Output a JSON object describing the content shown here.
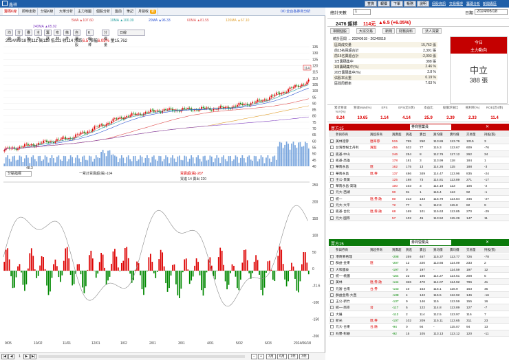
{
  "app": {
    "title": "鑫祥",
    "top_buttons": [
      "查詢",
      "報價",
      "下單",
      "帳務",
      "說明"
    ],
    "top_links": [
      "個股資訊",
      "交易權證",
      "籌碼分析",
      "新聞專區"
    ]
  },
  "chart_tabs": [
    "籌碼K線",
    "即時走勢",
    "分點K線",
    "大單分析",
    "主力地圖",
    "個股分析",
    "盤前",
    "筆記",
    "月營收"
  ],
  "chart_tabs_badge": "新",
  "stock_header": {
    "right_info": "0/0 全台各券商分析"
  },
  "ma_legend": [
    {
      "label": "5MA",
      "value": "▲107.60",
      "color": "#d63a3a"
    },
    {
      "label": "10MA",
      "value": "▲100.39",
      "color": "#25a0a0"
    },
    {
      "label": "20MA",
      "value": "▲96.33",
      "color": "#2850d0"
    },
    {
      "label": "60MA",
      "value": "▲81.55",
      "color": "#e05050"
    },
    {
      "label": "120MA",
      "value": "▲67.10",
      "color": "#e0a030"
    },
    {
      "label": "240MA",
      "value": "▲65.92",
      "color": "#8040c0"
    }
  ],
  "op_buttons": [
    "均線",
    "分類",
    "疊加",
    "主力",
    "籌碼",
    "布林",
    "條件",
    "自選股",
    "K線棒",
    "分價量",
    "日線"
  ],
  "ohlc": {
    "date": "2024/06/18",
    "open_label": "開",
    "open": "111",
    "high_label": "高",
    "high": "118",
    "low_label": "低",
    "low": "111",
    "close_label": "收",
    "close": "114",
    "change_label": "漲跌",
    "change": "6.5",
    "pct_label": "漲幅",
    "pct": "6.05%",
    "vol_label": "量",
    "volume": "15,762"
  },
  "price_axis": [
    "135",
    "130",
    "125",
    "120",
    "115",
    "110",
    "105",
    "100",
    "95",
    "90",
    "85",
    "80",
    "75",
    "70",
    "65",
    "60",
    "55",
    "50",
    "45",
    "40"
  ],
  "price_marker": "114",
  "low_marker": "48.3",
  "indicator_header": {
    "select": "分點指標",
    "legend1": "一累計買賣超(張)-104",
    "legend2": "買賣超(張)-207",
    "legend3": "買進 14 賣出 220"
  },
  "indicator_axis": [
    "250",
    "200",
    "150",
    "100",
    "50",
    "0",
    "-21.6",
    "-100",
    "-150",
    "-200"
  ],
  "x_axis": [
    {
      "text": "9/05"
    },
    {
      "text": "10/02"
    },
    {
      "text": "11/01"
    },
    {
      "text": "12/01"
    },
    {
      "text": "1/02"
    },
    {
      "text": "2/01"
    },
    {
      "text": "3/01"
    },
    {
      "text": "4/01"
    },
    {
      "text": "5/02"
    },
    {
      "text": "6/03"
    },
    {
      "text": "2024/06/18"
    }
  ],
  "x_years": {
    "y2023": "2023",
    "y2024": "2024"
  },
  "bottom_nav": {
    "page": "1",
    "buttons": [
      "3月",
      "6月",
      "1年",
      "3年"
    ]
  },
  "right_panel": {
    "summary": {
      "label": "總計天數",
      "days": "1",
      "date_label": "日期",
      "date": "2024/06/18"
    },
    "quote_line": {
      "code": "2476 鉅祥",
      "price": "114元",
      "change": "▲6.5 (+6.05%)"
    },
    "tabs": [
      "相關個股",
      "大宗交易",
      "新聞",
      "財務資料",
      "法人買賣"
    ],
    "range": "統計區間 → 20240618 - 20240618",
    "stats": [
      {
        "label": "區間成交量",
        "value": "15,762 張"
      },
      {
        "label": "前15名買超合計",
        "value": "2,391 張"
      },
      {
        "label": "前15名賣超合計",
        "value": "-2,003 張"
      },
      {
        "label": "1日籌碼集中",
        "value": "388 張"
      },
      {
        "label": "1日籌碼集中(%)",
        "value": "2.46 %"
      },
      {
        "label": "20日籌碼集中(%)",
        "value": "2.8 %"
      },
      {
        "label": "佔股本比重",
        "value": "0.19 %"
      },
      {
        "label": "區間周轉率",
        "value": "7.63 %"
      }
    ],
    "today_box": {
      "title": "今日",
      "subtitle": "主力動向",
      "state": "中立",
      "amount": "388 張"
    },
    "metrics_head": [
      "累計營收YoY(%)",
      "營收MoM(%)",
      "EPS",
      "EPS(近4季)",
      "本益比",
      "股價淨值比",
      "殖利率(%)",
      "ROE(近4季)"
    ],
    "metrics_val": [
      "8.24",
      "10.65",
      "1.14",
      "4.14",
      "25.9",
      "3.39",
      "2.33",
      "11.4"
    ],
    "buy_title": "買方15",
    "sell_title": "賣方15",
    "table_headers": [
      "參與券商",
      "買超券商",
      "買賣超",
      "買進",
      "賣出",
      "買均價",
      "賣均價",
      "交易量",
      "持股(張)"
    ],
    "table_select": "券商營業員",
    "buyers": [
      [
        "美林證券",
        "匯率券",
        "515",
        "765",
        "250",
        "113.86",
        "113.76",
        "1015",
        "3"
      ],
      [
        "台灣摩根士丹利",
        "買超",
        "455",
        "532",
        "77",
        "115.3",
        "113.67",
        "609",
        "-76"
      ],
      [
        "凱基-中山",
        "",
        "246",
        "254",
        "8",
        "112.76",
        "117.12",
        "262",
        "34"
      ],
      [
        "凱基-高雄",
        "",
        "178",
        "181",
        "3",
        "113.99",
        "118",
        "184",
        "1"
      ],
      [
        "華南永昌",
        "匯",
        "162",
        "175",
        "13",
        "114.26",
        "115",
        "188",
        "-3"
      ],
      [
        "華南永昌",
        "匯,券",
        "137",
        "486",
        "349",
        "114.47",
        "113.96",
        "835",
        "-24"
      ],
      [
        "王公-景美",
        "",
        "125",
        "198",
        "73",
        "114.81",
        "113.89",
        "271",
        "-17"
      ],
      [
        "華南永昌-高雄",
        "",
        "100",
        "103",
        "3",
        "114.19",
        "113",
        "106",
        "-2"
      ],
      [
        "元大-西湖",
        "",
        "90",
        "91",
        "1",
        "115.4",
        "113",
        "92",
        "-1"
      ],
      [
        "統一",
        "匯,券,融",
        "80",
        "213",
        "133",
        "115.79",
        "114.84",
        "346",
        "-27"
      ],
      [
        "元大-大平",
        "",
        "72",
        "77",
        "5",
        "112.9",
        "115.8",
        "82",
        "9"
      ],
      [
        "凱基-台北",
        "匯,券,融",
        "68",
        "169",
        "101",
        "115.63",
        "113.85",
        "270",
        "-29"
      ],
      [
        "元大-國際",
        "",
        "57",
        "102",
        "45",
        "113.52",
        "115.29",
        "147",
        "11"
      ]
    ],
    "sellers": [
      [
        "港商麥格理",
        "",
        "-208",
        "259",
        "467",
        "115.37",
        "113.77",
        "726",
        "-78"
      ],
      [
        "群益-金東",
        "匯",
        "-207",
        "12",
        "220",
        "113.66",
        "114.09",
        "233",
        "2"
      ],
      [
        "大和國泰",
        "",
        "-197",
        "0",
        "197",
        "-",
        "114.59",
        "197",
        "12"
      ],
      [
        "統一-桃園",
        "",
        "-164",
        "22",
        "186",
        "114.27",
        "114.51",
        "208",
        "5"
      ],
      [
        "美林",
        "匯,券,融",
        "-144",
        "326",
        "470",
        "114.07",
        "114.92",
        "796",
        "41"
      ],
      [
        "元富-台南",
        "台,券",
        "-143",
        "10",
        "153",
        "115.1",
        "116.9",
        "163",
        "45"
      ],
      [
        "群益金鼎-大直",
        "",
        "-138",
        "4",
        "142",
        "115.5",
        "112.92",
        "146",
        "-16"
      ],
      [
        "王公-新竹",
        "",
        "-137",
        "9",
        "146",
        "115",
        "113.59",
        "155",
        "16"
      ],
      [
        "統一-南京",
        "台",
        "-117",
        "5",
        "122",
        "114.8",
        "113.89",
        "127",
        "-7"
      ],
      [
        "大展",
        "",
        "-112",
        "2",
        "114",
        "112.5",
        "113.97",
        "116",
        "7"
      ],
      [
        "新光",
        "匯,券",
        "-107",
        "102",
        "209",
        "115.11",
        "113.65",
        "311",
        "23"
      ],
      [
        "元大-台東",
        "台,融",
        "-94",
        "0",
        "94",
        "-",
        "115.07",
        "94",
        "13"
      ],
      [
        "兆豐-彰銀",
        "",
        "-92",
        "15",
        "105",
        "113.13",
        "113.12",
        "120",
        "-11"
      ]
    ]
  },
  "colors": {
    "up": "#d00000",
    "down": "#008800",
    "blue": "#1f5fa8",
    "buy_header": "#c40000",
    "sell_header": "#0b7a0b"
  }
}
